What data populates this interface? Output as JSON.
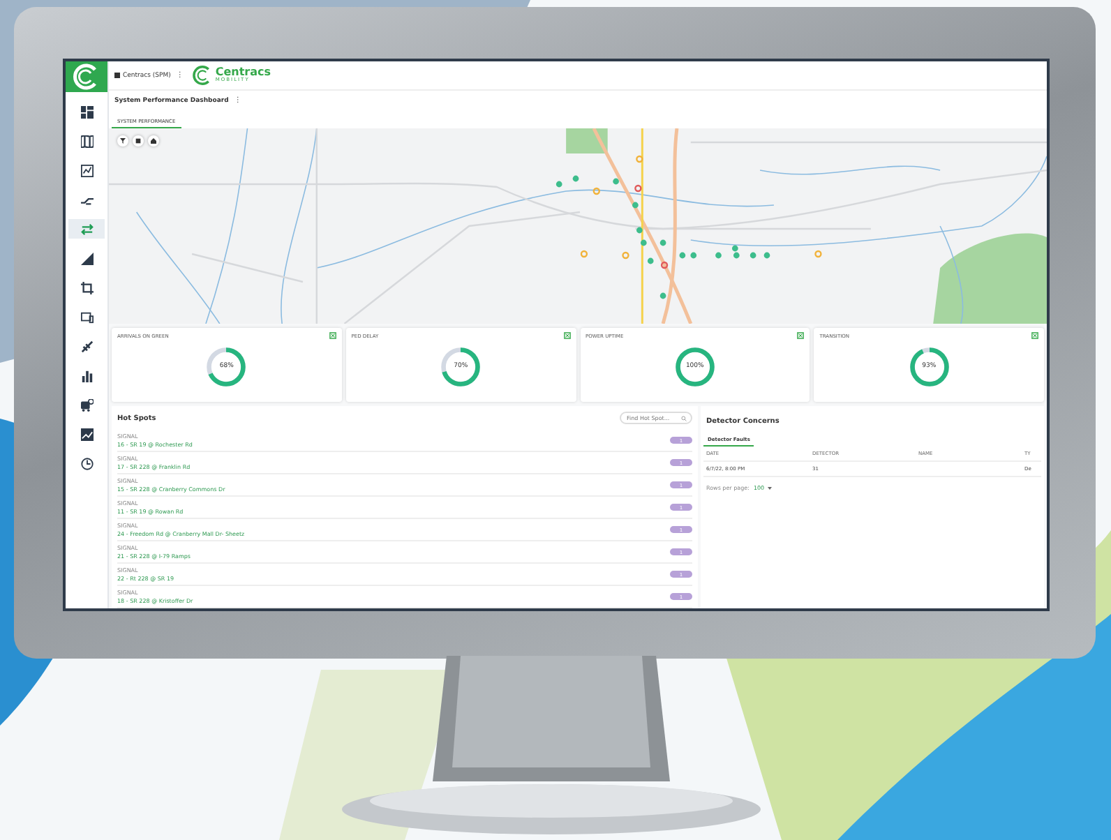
{
  "header": {
    "app_name": "Centracs (SPM)",
    "menu_glyph": "⋮",
    "logo_name": "Centracs",
    "logo_sub": "MOBILITY"
  },
  "page": {
    "title": "System Performance Dashboard",
    "menu_glyph": "⋮"
  },
  "sidebar": {
    "items": [
      {
        "kind": "dashboard",
        "selected": false
      },
      {
        "kind": "map",
        "selected": false
      },
      {
        "kind": "report",
        "selected": false
      },
      {
        "kind": "ramp",
        "selected": false
      },
      {
        "kind": "swap",
        "selected": true
      },
      {
        "kind": "signal",
        "selected": false
      },
      {
        "kind": "crop",
        "selected": false
      },
      {
        "kind": "devices",
        "selected": false
      },
      {
        "kind": "satellite",
        "selected": false
      },
      {
        "kind": "bars",
        "selected": false
      },
      {
        "kind": "bus",
        "selected": false
      },
      {
        "kind": "image",
        "selected": false
      },
      {
        "kind": "clock",
        "selected": false
      }
    ]
  },
  "tabs": [
    {
      "label": "SYSTEM PERFORMANCE",
      "selected": true
    }
  ],
  "map_controls": [
    {
      "kind": "filter"
    },
    {
      "kind": "layers"
    },
    {
      "kind": "home"
    }
  ],
  "metrics": [
    {
      "title": "ARRIVALS ON GREEN",
      "reading": "68%",
      "level": 0.68
    },
    {
      "title": "PED DELAY",
      "reading": "70%",
      "level": 0.7
    },
    {
      "title": "POWER UPTIME",
      "reading": "100%",
      "level": 1.0
    },
    {
      "title": "TRANSITION",
      "reading": "93%",
      "level": 0.93
    }
  ],
  "hot_spots": {
    "title": "Hot Spots",
    "search": {
      "placeholder": "Find Hot Spot..."
    },
    "rows": [
      {
        "type": "SIGNAL",
        "name": "16 - SR 19 @ Rochester Rd",
        "count": "1"
      },
      {
        "type": "SIGNAL",
        "name": "17 - SR 228 @ Franklin Rd",
        "count": "1"
      },
      {
        "type": "SIGNAL",
        "name": "15 - SR 228 @ Cranberry Commons Dr",
        "count": "1"
      },
      {
        "type": "SIGNAL",
        "name": "11 - SR 19 @ Rowan Rd",
        "count": "1"
      },
      {
        "type": "SIGNAL",
        "name": "24 - Freedom Rd @ Cranberry Mall Dr- Sheetz",
        "count": "1"
      },
      {
        "type": "SIGNAL",
        "name": "21 - SR 228 @ I-79 Ramps",
        "count": "1"
      },
      {
        "type": "SIGNAL",
        "name": "22 - Rt 228 @ SR 19",
        "count": "1"
      },
      {
        "type": "SIGNAL",
        "name": "18 - SR 228 @ Kristoffer Dr",
        "count": "1"
      }
    ]
  },
  "detector_concerns": {
    "title": "Detector Concerns",
    "tabs": [
      {
        "label": "Detector Faults",
        "selected": true
      }
    ],
    "columns": [
      "DATE",
      "DETECTOR",
      "NAME",
      "TY"
    ],
    "rows": [
      [
        "6/7/22, 8:00 PM",
        "31",
        "",
        "De"
      ]
    ],
    "rows_per_page_label": "Rows per page:",
    "rows_per_page": "100"
  }
}
